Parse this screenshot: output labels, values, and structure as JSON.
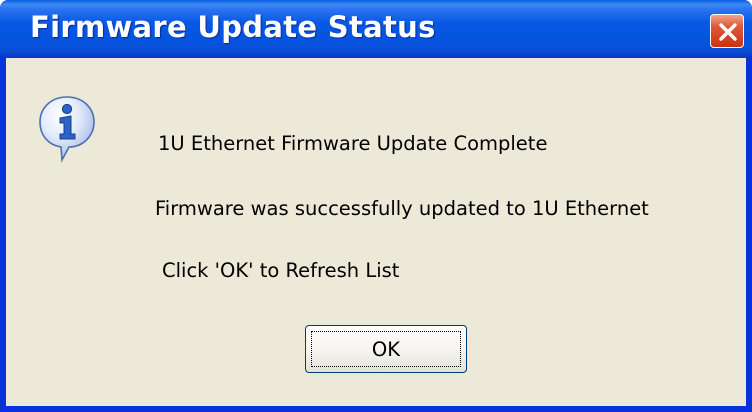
{
  "dialog": {
    "title": "Firmware Update Status",
    "icon": "information-icon",
    "messages": [
      "1U Ethernet Firmware Update Complete",
      "Firmware was successfully updated to 1U Ethernet",
      "Click 'OK' to Refresh List"
    ],
    "ok_label": "OK",
    "close_icon": "close-icon"
  },
  "colors": {
    "titlebar": "#0554e0",
    "client_background": "#ece9d8",
    "close_button": "#e2593a",
    "info_icon": "#2a63c9"
  }
}
